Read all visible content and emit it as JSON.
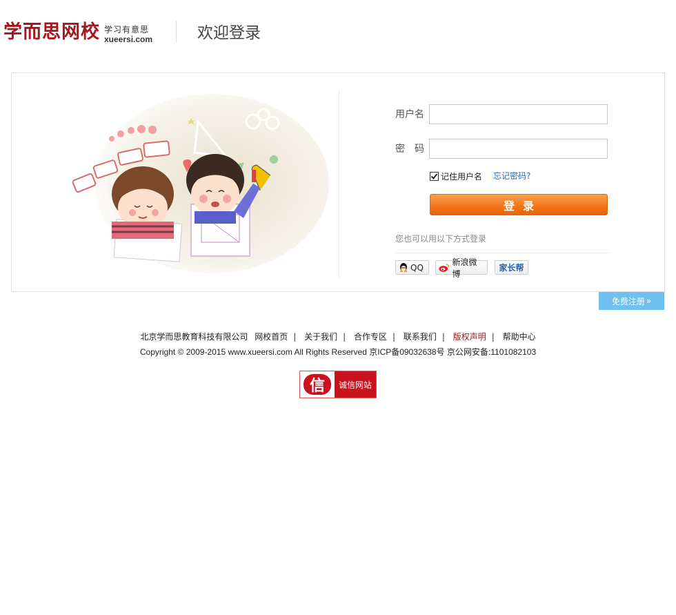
{
  "header": {
    "logo_cn": "学而思网校",
    "logo_slogan": "学习有意思",
    "logo_domain": "xueersi.com",
    "title": "欢迎登录"
  },
  "form": {
    "username_label": "用户名",
    "username_value": "",
    "password_label": "密　码",
    "password_value": "",
    "remember_checked": true,
    "remember_label": "记住用户名",
    "forgot_label": "忘记密码?",
    "login_label": "登录",
    "alt_login_text": "您也可以用以下方式登录",
    "social": [
      {
        "label": "QQ",
        "icon": "qq-penguin-icon"
      },
      {
        "label": "新浪微博",
        "icon": "weibo-icon"
      },
      {
        "label": "家长帮",
        "icon": ""
      }
    ]
  },
  "register_label": "免费注册",
  "footer": {
    "company": "北京学而思教育科技有限公司",
    "links": [
      "网校首页",
      "关于我们",
      "合作专区",
      "联系我们",
      "版权声明",
      "帮助中心"
    ],
    "copyright": "Copyright © 2009-2015 www.xueersi.com All Rights Reserved 京ICP备09032638号 京公网安备:1101082103",
    "badge_char": "信",
    "badge_text": "诚信网站"
  },
  "colors": {
    "brand_red": "#a7151d",
    "login_orange": "#f1761a",
    "register_blue": "#6ec1ee",
    "link_blue": "#2a6aa8"
  }
}
